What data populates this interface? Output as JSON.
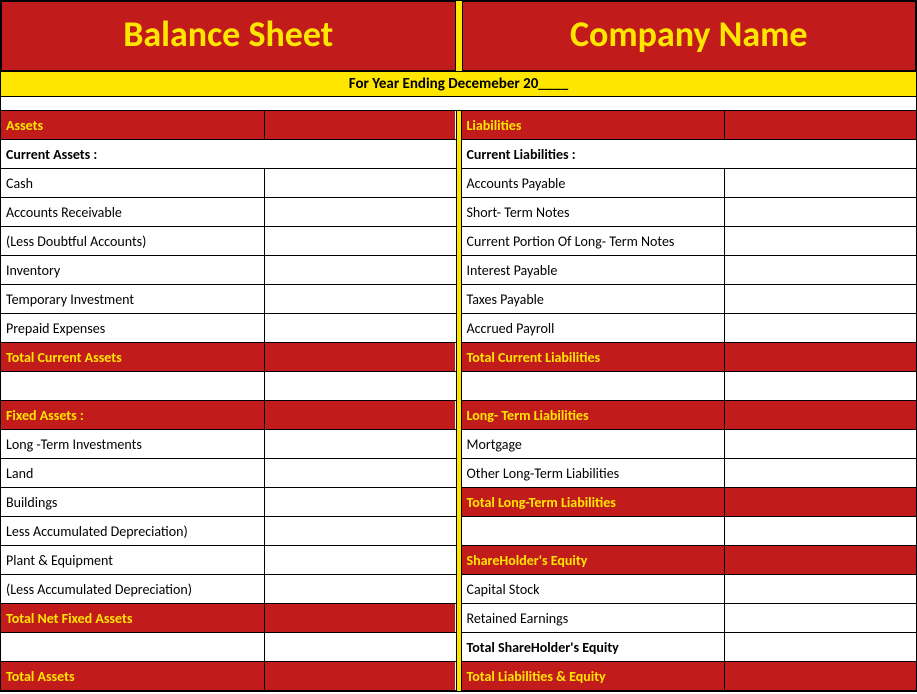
{
  "header": {
    "left": "Balance Sheet",
    "right": "Company Name",
    "sub": "For Year Ending Decemeber 20____"
  },
  "left": {
    "sectionHeader": "Assets",
    "r1": "Current Assets :",
    "r2": "Cash",
    "r3": "Accounts Receivable",
    "r4": "(Less Doubtful Accounts)",
    "r5": "Inventory",
    "r6": "Temporary Investment",
    "r7": "Prepaid Expenses",
    "totalCurrent": "Total Current Assets",
    "fixedHeader": "Fixed Assets :",
    "f1": "Long -Term Investments",
    "f2": "Land",
    "f3": "Buildings",
    "f4": "Less Accumulated Depreciation)",
    "f5": "Plant & Equipment",
    "f6": "(Less Accumulated Depreciation)",
    "totalNetFixed": "Total Net Fixed Assets",
    "totalAssets": "Total Assets"
  },
  "right": {
    "sectionHeader": "Liabilities",
    "r1": "Current Liabilities :",
    "r2": "Accounts Payable",
    "r3": "Short- Term Notes",
    "r4": "Current Portion Of Long- Term Notes",
    "r5": "Interest Payable",
    "r6": "Taxes Payable",
    "r7": "Accrued Payroll",
    "totalCurrent": "Total Current Liabilities",
    "ltHeader": "Long- Term Liabilities",
    "lt1": "Mortgage",
    "lt2": "Other Long-Term Liabilities",
    "totalLT": "Total Long-Term Liabilities",
    "equityHeader": "ShareHolder's Equity",
    "eq1": "Capital Stock",
    "eq2": "Retained Earnings",
    "totalEquity": "Total ShareHolder's Equity",
    "totalLE": "Total Liabilities & Equity"
  }
}
